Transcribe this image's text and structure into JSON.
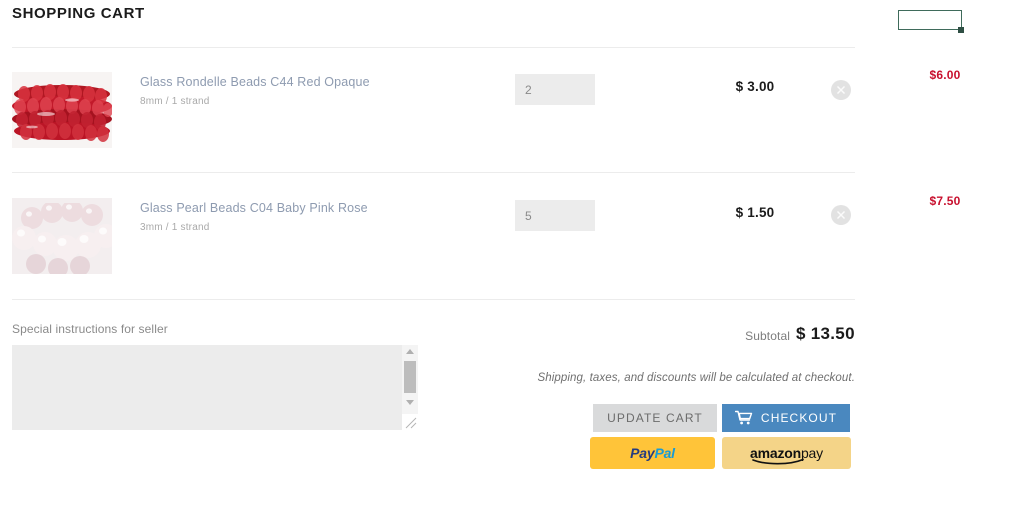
{
  "page": {
    "title": "SHOPPING CART"
  },
  "annotation": {
    "box_color": "#3f6b5b",
    "handle_color": "#2f4f44"
  },
  "cart": {
    "items": [
      {
        "title": "Glass Rondelle Beads C44 Red Opaque",
        "variant": "8mm / 1 strand",
        "quantity": "2",
        "unit_price": "$ 3.00",
        "line_total": "$6.00",
        "remove_icon": "close-circle-icon",
        "thumbnail": "red-rondelle-beads-photo"
      },
      {
        "title": "Glass Pearl Beads C04 Baby Pink Rose",
        "variant": "3mm / 1 strand",
        "quantity": "5",
        "unit_price": "$ 1.50",
        "line_total": "$7.50",
        "remove_icon": "close-circle-icon",
        "thumbnail": "pink-pearl-beads-photo"
      }
    ]
  },
  "notes": {
    "label": "Special instructions for seller",
    "value": "",
    "placeholder": ""
  },
  "summary": {
    "subtotal_label": "Subtotal",
    "subtotal_value": "$ 13.50",
    "shipping_note": "Shipping, taxes, and discounts will be calculated at checkout."
  },
  "actions": {
    "update_cart": "UPDATE CART",
    "checkout": "CHECKOUT",
    "checkout_icon": "shopping-cart-icon",
    "paypal": {
      "part1": "Pay",
      "part2": "Pal"
    },
    "amazon": {
      "part1": "amazon",
      "part2": "pay"
    }
  },
  "colors": {
    "link": "#8e9bb0",
    "price_red": "#c8102e",
    "checkout_blue": "#4a88bf",
    "update_gray": "#d9dadb",
    "paypal_yellow": "#ffc439",
    "amazon_yellow": "#f4d488"
  }
}
